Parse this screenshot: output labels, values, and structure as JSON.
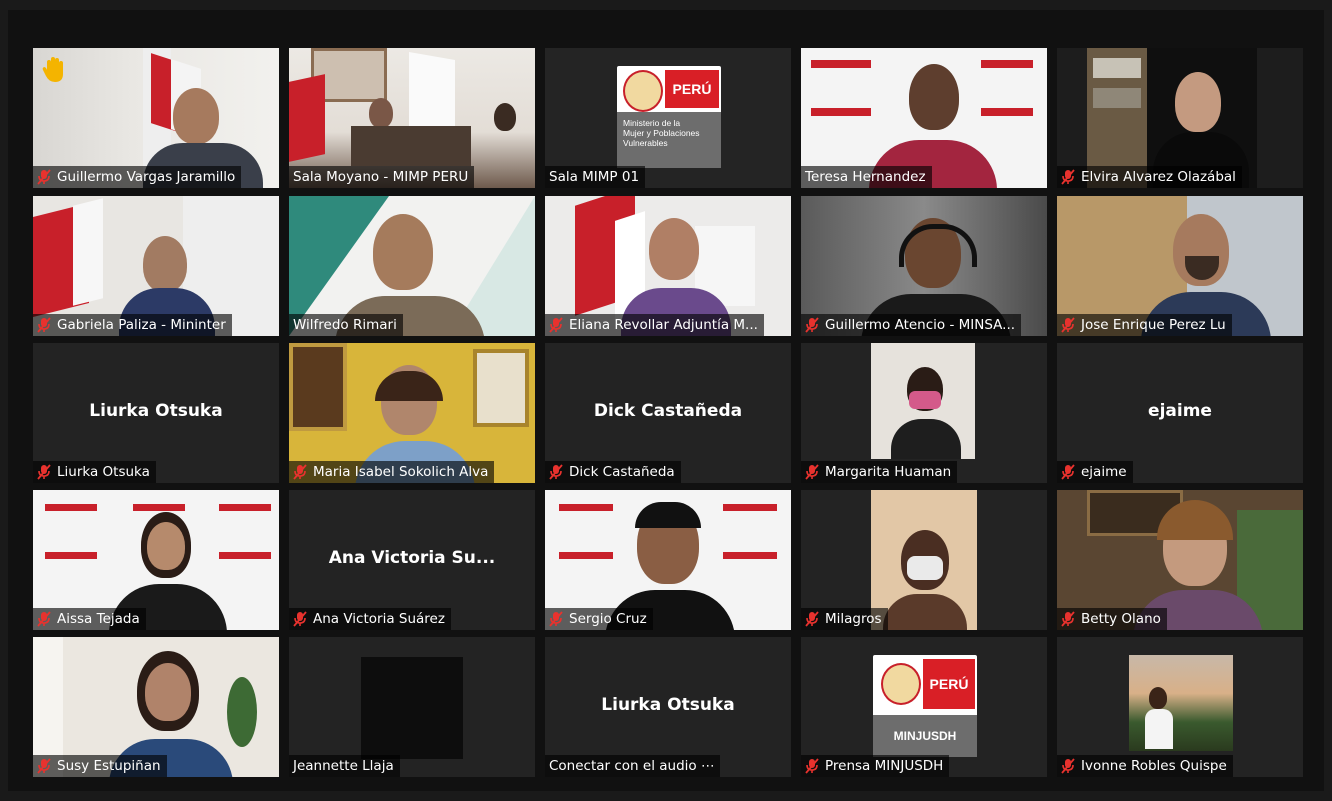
{
  "colors": {
    "active_border": "#c9d45a",
    "muted_icon": "#e8322e",
    "peru_red": "#d91f26",
    "tile_bg": "#232323"
  },
  "tiles": [
    {
      "caption": "Guillermo Vargas Jaramillo",
      "muted": true,
      "hand": true
    },
    {
      "caption": "Sala Moyano - MIMP PERU",
      "muted": false
    },
    {
      "caption": "Sala MIMP 01",
      "muted": false,
      "active": true,
      "logo": {
        "brand": "PERÚ",
        "lines": [
          "Ministerio de la",
          "Mujer y Poblaciones",
          "Vulnerables"
        ]
      }
    },
    {
      "caption": "Teresa Hernandez",
      "muted": false
    },
    {
      "caption": "Elvira Alvarez Olazábal",
      "muted": true
    },
    {
      "caption": "Gabriela Paliza - Mininter",
      "muted": true
    },
    {
      "caption": "Wilfredo Rimari",
      "muted": false
    },
    {
      "caption": "Eliana Revollar Adjuntía M...",
      "muted": true
    },
    {
      "caption": "Guillermo Atencio - MINSA...",
      "muted": true
    },
    {
      "caption": "Jose Enrique Perez Lu",
      "muted": true
    },
    {
      "caption": "Liurka Otsuka",
      "muted": true,
      "center": "Liurka Otsuka"
    },
    {
      "caption": "Maria Isabel Sokolich Alva",
      "muted": true
    },
    {
      "caption": "Dick Castañeda",
      "muted": true,
      "center": "Dick Castañeda"
    },
    {
      "caption": "Margarita Huaman",
      "muted": true
    },
    {
      "caption": "ejaime",
      "muted": true,
      "center": "ejaime"
    },
    {
      "caption": "Aissa Tejada",
      "muted": true
    },
    {
      "caption": "Ana Victoria Suárez",
      "muted": true,
      "center": "Ana Victoria Su..."
    },
    {
      "caption": "Sergio Cruz",
      "muted": true
    },
    {
      "caption": "Milagros",
      "muted": true
    },
    {
      "caption": "Betty Olano",
      "muted": true
    },
    {
      "caption": "Susy Estupiñan",
      "muted": true
    },
    {
      "caption": "Jeannette Llaja",
      "muted": false
    },
    {
      "caption": "Conectar con el audio ⋯",
      "muted": false,
      "center": "Liurka Otsuka"
    },
    {
      "caption": "Prensa MINJUSDH",
      "muted": true,
      "logo": {
        "brand": "PERÚ",
        "lines": [
          "MINJUSDH"
        ]
      }
    },
    {
      "caption": "Ivonne Robles Quispe",
      "muted": true
    }
  ]
}
